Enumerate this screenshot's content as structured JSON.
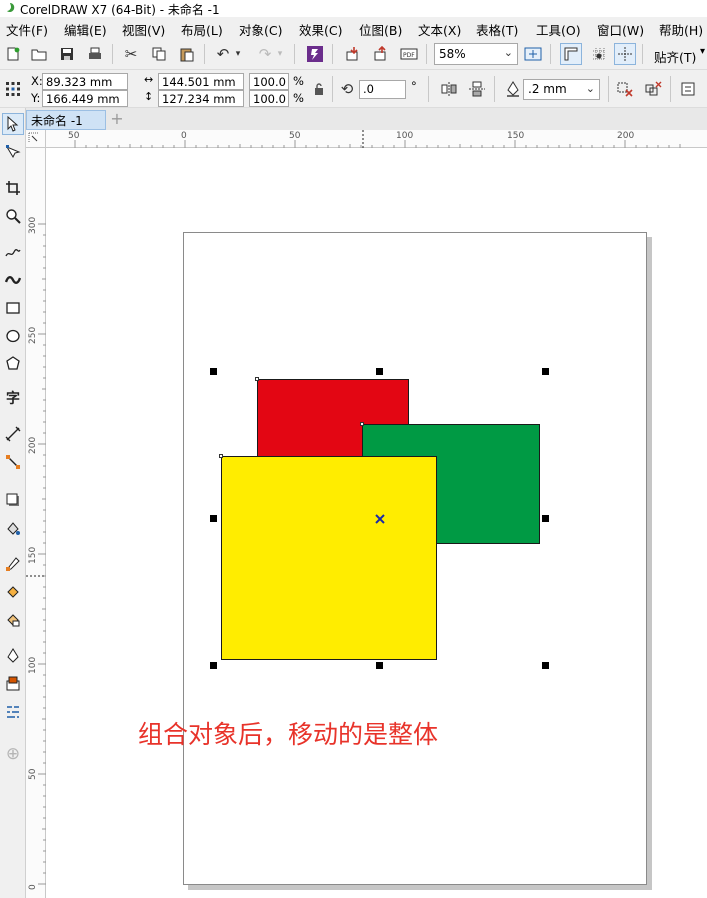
{
  "window": {
    "title": "CorelDRAW X7 (64-Bit) - 未命名 -1"
  },
  "menu": [
    "文件(F)",
    "编辑(E)",
    "视图(V)",
    "布局(L)",
    "对象(C)",
    "效果(C)",
    "位图(B)",
    "文本(X)",
    "表格(T)",
    "工具(O)",
    "窗口(W)",
    "帮助(H)"
  ],
  "toolbar": {
    "zoom": "58%",
    "snap_label": "贴齐(T)"
  },
  "properties": {
    "x_label": "X:",
    "y_label": "Y:",
    "x": "89.323 mm",
    "y": "166.449 mm",
    "width": "144.501 mm",
    "height": "127.234 mm",
    "scale_w": "100.0",
    "scale_h": "100.0",
    "percent": "%",
    "rotation": ".0",
    "degree": "°",
    "outline_width": ".2 mm"
  },
  "document": {
    "tab_label": "未命名 -1",
    "add_tab": "+"
  },
  "ruler": {
    "h_ticks": [
      "50",
      "0",
      "50",
      "100",
      "150",
      "200"
    ],
    "v_ticks": [
      "300",
      "250",
      "200",
      "150",
      "100",
      "50",
      "0"
    ]
  },
  "shapes": {
    "red_color": "#e30613",
    "green_color": "#009a44",
    "yellow_color": "#ffed00"
  },
  "annotation": "组合对象后，移动的是整体"
}
